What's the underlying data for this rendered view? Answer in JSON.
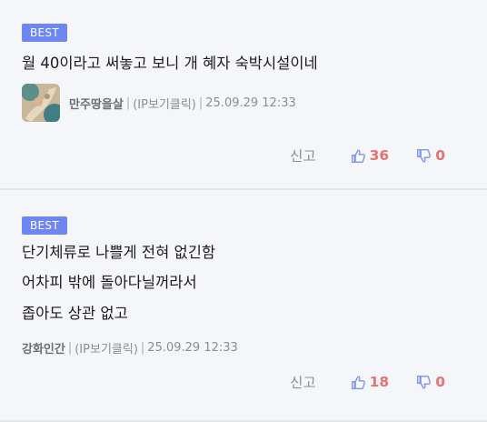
{
  "comments": [
    {
      "badge": "BEST",
      "lines": [
        "월 40이라고 써놓고 보니 개 혜자 숙박시설이네"
      ],
      "nickname": "만주땅을살",
      "ip_label": "(IP보기클릭)",
      "date": "25.09.29 12:33",
      "report_label": "신고",
      "likes": "36",
      "dislikes": "0",
      "has_avatar": true
    },
    {
      "badge": "BEST",
      "lines": [
        "단기체류로 나쁠게 전혀 없긴함",
        "어차피 밖에 돌아다닐꺼라서",
        "좁아도 상관 없고"
      ],
      "nickname": "강화인간",
      "ip_label": "(IP보기클릭)",
      "date": "25.09.29 12:33",
      "report_label": "신고",
      "likes": "18",
      "dislikes": "0",
      "has_avatar": false
    }
  ],
  "colors": {
    "badge_bg": "#6d86f2",
    "vote_count": "#e57373",
    "thumb_icon": "#7f93e6",
    "background": "#f5f6fa"
  },
  "icons": {
    "like": "thumbs-up-outline-icon",
    "dislike": "thumbs-down-outline-icon"
  }
}
